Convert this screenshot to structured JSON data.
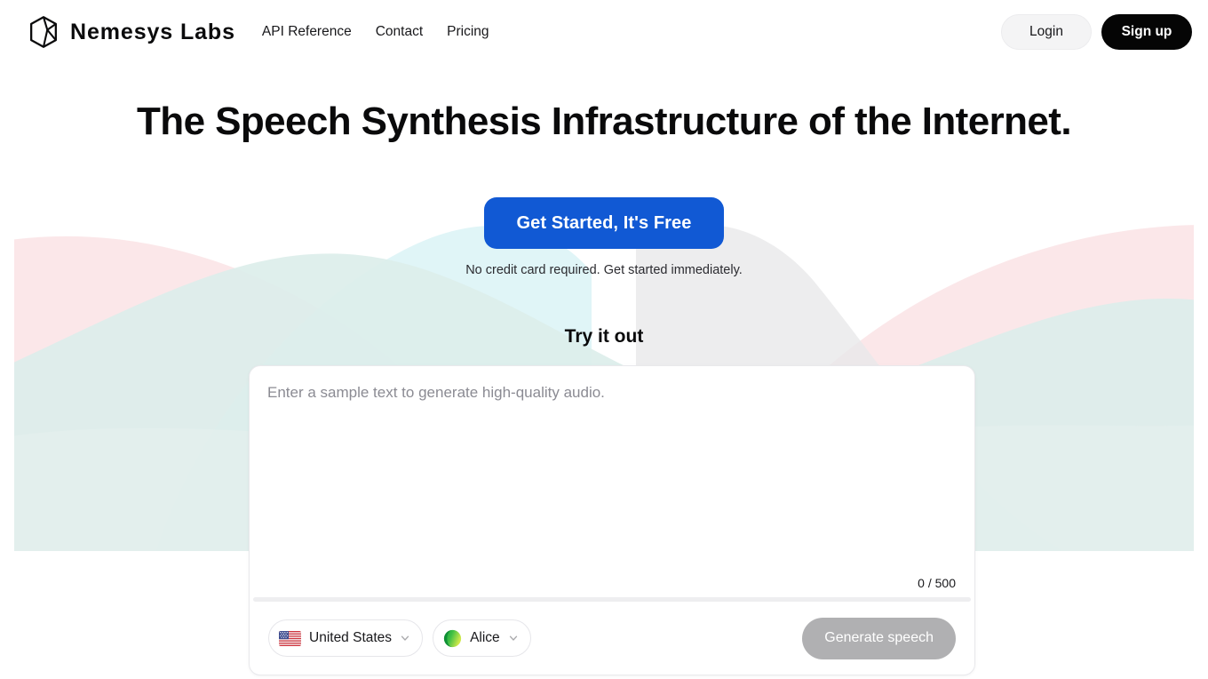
{
  "header": {
    "brand": {
      "name": "Nemesys  Labs",
      "logo_icon": "hexagon-cube-logo-icon"
    },
    "nav": [
      {
        "label": "API Reference"
      },
      {
        "label": "Contact"
      },
      {
        "label": "Pricing"
      }
    ],
    "login_label": "Login",
    "signup_label": "Sign up"
  },
  "hero": {
    "title": "The Speech Synthesis Infrastructure of the Internet.",
    "cta_label": "Get Started, It's Free",
    "cta_note": "No credit card required. Get started immediately."
  },
  "demo": {
    "section_title": "Try it out",
    "textarea_placeholder": "Enter a sample text to generate high-quality audio.",
    "textarea_value": "",
    "char_count": "0 / 500",
    "language_chip": {
      "label": "United States",
      "icon": "us-flag-icon",
      "chevron": "chevron-down-icon"
    },
    "voice_chip": {
      "label": "Alice",
      "icon": "voice-avatar-icon",
      "chevron": "chevron-down-icon"
    },
    "generate_label": "Generate speech"
  },
  "colors": {
    "cta_blue": "#1159d4",
    "signup_black": "#050505",
    "login_gray": "#f4f4f5",
    "generate_gray": "#b0b0b2",
    "wave_mint": "#dceeea",
    "wave_pink": "#fae3e5",
    "wave_gray": "#e9e9ea",
    "wave_cyan": "#ddf4f6"
  }
}
